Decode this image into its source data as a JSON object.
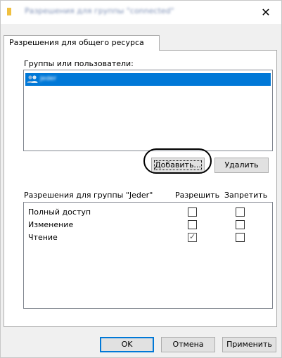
{
  "window": {
    "title": "Разрешения для группы \"connected\"",
    "close_glyph": "✕"
  },
  "tabs": [
    {
      "label": "Разрешения для общего ресурса"
    }
  ],
  "groups": {
    "label": "Группы или пользователи:",
    "items": [
      {
        "name": "Jeder",
        "selected": true,
        "icon": "users-icon"
      }
    ]
  },
  "buttons": {
    "add": "Добавить...",
    "remove": "Удалить",
    "ok": "OK",
    "cancel": "Отмена",
    "apply": "Применить"
  },
  "permissions": {
    "header": "Разрешения для группы \"Jeder\"",
    "allow_header": "Разрешить",
    "deny_header": "Запретить",
    "rows": [
      {
        "name": "Полный доступ",
        "allow": false,
        "deny": false
      },
      {
        "name": "Изменение",
        "allow": false,
        "deny": false
      },
      {
        "name": "Чтение",
        "allow": true,
        "deny": false
      }
    ]
  },
  "colors": {
    "selection": "#0078d7",
    "dialog_bg": "#f0f0f0",
    "button_bg": "#e1e1e1",
    "highlight_ring": "#000000"
  }
}
